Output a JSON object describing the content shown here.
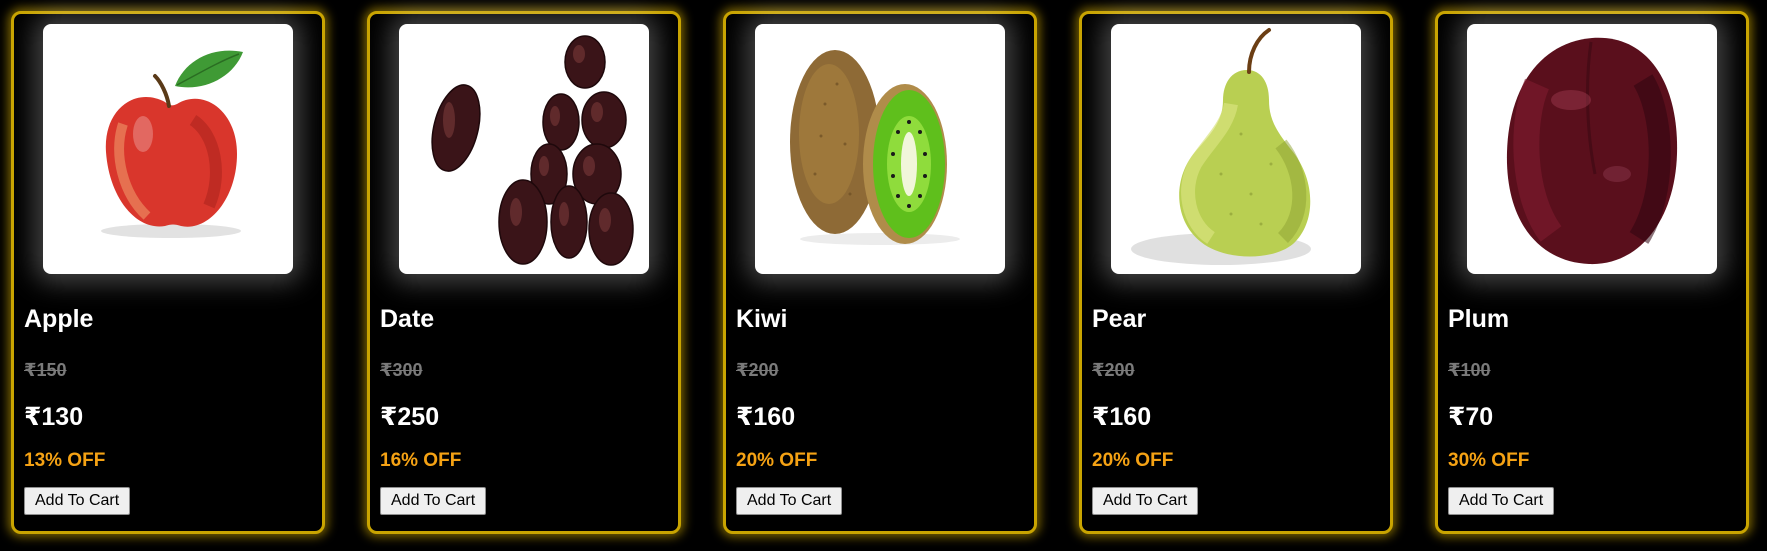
{
  "currency_symbol": "₹",
  "colors": {
    "background": "#000000",
    "card_border": "#c9a400",
    "discount_text": "#f5a214",
    "old_price_text": "#7a7a7a"
  },
  "products": [
    {
      "name": "Apple",
      "old_price": "₹150",
      "new_price": "₹130",
      "discount": "13% OFF",
      "button_label": "Add To Cart",
      "image": "apple-image"
    },
    {
      "name": "Date",
      "old_price": "₹300",
      "new_price": "₹250",
      "discount": "16% OFF",
      "button_label": "Add To Cart",
      "image": "dates-image"
    },
    {
      "name": "Kiwi",
      "old_price": "₹200",
      "new_price": "₹160",
      "discount": "20% OFF",
      "button_label": "Add To Cart",
      "image": "kiwi-image"
    },
    {
      "name": "Pear",
      "old_price": "₹200",
      "new_price": "₹160",
      "discount": "20% OFF",
      "button_label": "Add To Cart",
      "image": "pear-image"
    },
    {
      "name": "Plum",
      "old_price": "₹100",
      "new_price": "₹70",
      "discount": "30% OFF",
      "button_label": "Add To Cart",
      "image": "plum-image"
    }
  ]
}
